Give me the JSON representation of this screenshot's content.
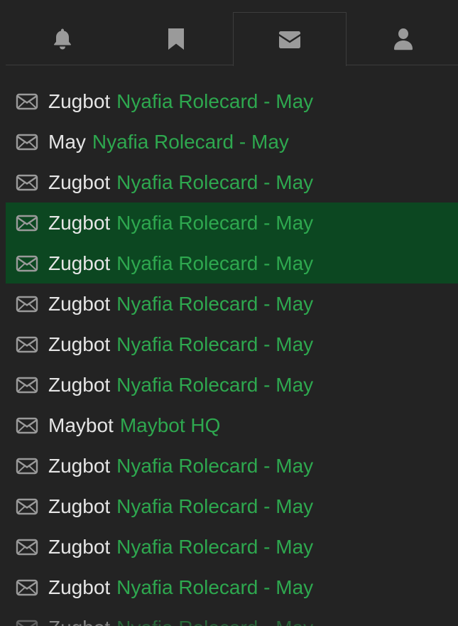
{
  "tabs": [
    {
      "icon": "bell-icon",
      "active": false
    },
    {
      "icon": "bookmark-icon",
      "active": false
    },
    {
      "icon": "envelope-icon",
      "active": true
    },
    {
      "icon": "user-icon",
      "active": false
    }
  ],
  "colors": {
    "background": "#232323",
    "sender_text": "#e6e6e6",
    "subject_text": "#2ea84f",
    "highlight_row": "#0c4721",
    "icon": "#9a9a9a"
  },
  "messages": [
    {
      "sender": "Zugbot",
      "subject": "Nyafia Rolecard - May",
      "highlighted": false
    },
    {
      "sender": "May",
      "subject": "Nyafia Rolecard - May",
      "highlighted": false
    },
    {
      "sender": "Zugbot",
      "subject": "Nyafia Rolecard - May",
      "highlighted": false
    },
    {
      "sender": "Zugbot",
      "subject": "Nyafia Rolecard - May",
      "highlighted": true
    },
    {
      "sender": "Zugbot",
      "subject": "Nyafia Rolecard - May",
      "highlighted": true
    },
    {
      "sender": "Zugbot",
      "subject": "Nyafia Rolecard - May",
      "highlighted": false
    },
    {
      "sender": "Zugbot",
      "subject": "Nyafia Rolecard - May",
      "highlighted": false
    },
    {
      "sender": "Zugbot",
      "subject": "Nyafia Rolecard - May",
      "highlighted": false
    },
    {
      "sender": "Maybot",
      "subject": "Maybot HQ",
      "highlighted": false
    },
    {
      "sender": "Zugbot",
      "subject": "Nyafia Rolecard - May",
      "highlighted": false
    },
    {
      "sender": "Zugbot",
      "subject": "Nyafia Rolecard - May",
      "highlighted": false
    },
    {
      "sender": "Zugbot",
      "subject": "Nyafia Rolecard - May",
      "highlighted": false
    },
    {
      "sender": "Zugbot",
      "subject": "Nyafia Rolecard - May",
      "highlighted": false
    },
    {
      "sender": "Zugbot",
      "subject": "Nyafia Rolecard - May",
      "highlighted": false
    }
  ]
}
